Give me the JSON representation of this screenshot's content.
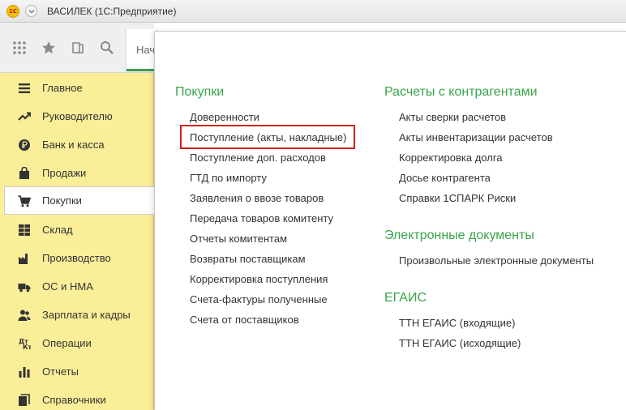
{
  "window": {
    "logo_text": "1C",
    "title": "ВАСИЛЕК  (1С:Предприятие)"
  },
  "tab": {
    "label": "Начальная страница"
  },
  "sidebar": {
    "items": [
      {
        "label": "Главное",
        "icon": "menu-lines-icon"
      },
      {
        "label": "Руководителю",
        "icon": "trend-chart-icon"
      },
      {
        "label": "Банк и касса",
        "icon": "ruble-coin-icon"
      },
      {
        "label": "Продажи",
        "icon": "shopping-bag-icon"
      },
      {
        "label": "Покупки",
        "icon": "shopping-cart-icon"
      },
      {
        "label": "Склад",
        "icon": "warehouse-grid-icon"
      },
      {
        "label": "Производство",
        "icon": "factory-icon"
      },
      {
        "label": "ОС и НМА",
        "icon": "truck-icon"
      },
      {
        "label": "Зарплата и кадры",
        "icon": "people-icon"
      },
      {
        "label": "Операции",
        "icon": "debit-credit-icon"
      },
      {
        "label": "Отчеты",
        "icon": "bar-chart-icon"
      },
      {
        "label": "Справочники",
        "icon": "books-icon"
      }
    ],
    "active_index": 4
  },
  "panel": {
    "col1": {
      "title": "Покупки",
      "links": [
        "Доверенности",
        "Поступление (акты, накладные)",
        "Поступление доп. расходов",
        "ГТД по импорту",
        "Заявления о ввозе товаров",
        "Передача товаров комитенту",
        "Отчеты комитентам",
        "Возвраты поставщикам",
        "Корректировка поступления",
        "Счета-фактуры полученные",
        "Счета от поставщиков"
      ]
    },
    "col2": {
      "sections": [
        {
          "title": "Расчеты с контрагентами",
          "links": [
            "Акты сверки расчетов",
            "Акты инвентаризации расчетов",
            "Корректировка долга",
            "Досье контрагента",
            "Справки 1СПАРК Риски"
          ]
        },
        {
          "title": "Электронные документы",
          "links": [
            "Произвольные электронные документы"
          ]
        },
        {
          "title": "ЕГАИС",
          "links": [
            "ТТН ЕГАИС (входящие)",
            "ТТН ЕГАИС (исходящие)"
          ]
        }
      ]
    }
  },
  "colors": {
    "accent_green": "#3aa44a",
    "sidebar_bg": "#fbee99",
    "highlight_red": "#d41f1f"
  }
}
